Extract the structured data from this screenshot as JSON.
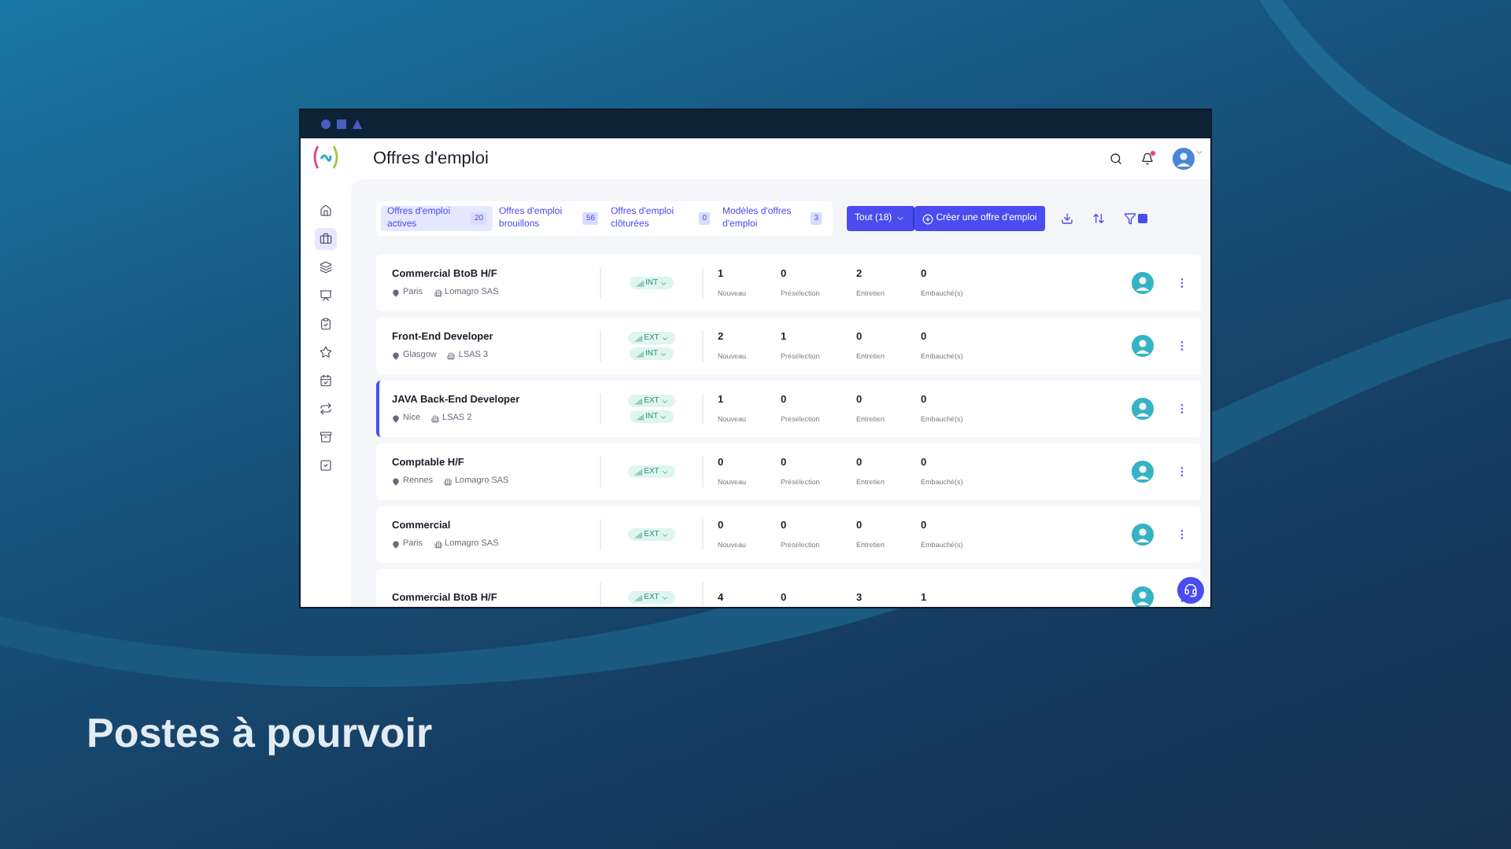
{
  "window": {
    "title": "Offres d'emploi"
  },
  "sidebar": {
    "items": [
      {
        "kind": "home",
        "selected": false
      },
      {
        "kind": "briefcase",
        "selected": true
      },
      {
        "kind": "layers",
        "selected": false
      },
      {
        "kind": "presentation",
        "selected": false
      },
      {
        "kind": "clipboard",
        "selected": false
      },
      {
        "kind": "star",
        "selected": false
      },
      {
        "kind": "calendar",
        "selected": false
      },
      {
        "kind": "repeat",
        "selected": false
      },
      {
        "kind": "archive",
        "selected": false
      },
      {
        "kind": "check",
        "selected": false
      }
    ]
  },
  "tabs": [
    {
      "label": "Offres d'emploi actives",
      "count": "20",
      "selected": true
    },
    {
      "label": "Offres d'emploi brouillons",
      "count": "56",
      "selected": false
    },
    {
      "label": "Offres d'emploi clôturées",
      "count": "0",
      "selected": false
    },
    {
      "label": "Modèles d'offres d'emploi",
      "count": "3",
      "selected": false
    }
  ],
  "filter_button": {
    "label": "Tout (18)"
  },
  "create_button": {
    "label": "Créer une offre d'emploi"
  },
  "rows": [
    {
      "name": "Commercial BtoB H/F",
      "location": "Paris",
      "company": "Lomagro SAS",
      "selected": false,
      "tags": [
        {
          "label": "INT"
        }
      ],
      "stats": [
        {
          "value": "1",
          "label": "Nouveau"
        },
        {
          "value": "0",
          "label": "Présélection"
        },
        {
          "value": "2",
          "label": "Entretien"
        },
        {
          "value": "0",
          "label": "Embauché(s)"
        }
      ]
    },
    {
      "name": "Front-End Developer",
      "location": "Glasgow",
      "company": "LSAS 3",
      "selected": false,
      "tags": [
        {
          "label": "EXT"
        },
        {
          "label": "INT"
        }
      ],
      "stats": [
        {
          "value": "2",
          "label": "Nouveau"
        },
        {
          "value": "1",
          "label": "Présélection"
        },
        {
          "value": "0",
          "label": "Entretien"
        },
        {
          "value": "0",
          "label": "Embauché(s)"
        }
      ]
    },
    {
      "name": "JAVA Back-End Developer",
      "location": "Nice",
      "company": "LSAS 2",
      "selected": true,
      "tags": [
        {
          "label": "EXT"
        },
        {
          "label": "INT"
        }
      ],
      "stats": [
        {
          "value": "1",
          "label": "Nouveau"
        },
        {
          "value": "0",
          "label": "Présélection"
        },
        {
          "value": "0",
          "label": "Entretien"
        },
        {
          "value": "0",
          "label": "Embauché(s)"
        }
      ]
    },
    {
      "name": "Comptable H/F",
      "location": "Rennes",
      "company": "Lomagro SAS",
      "selected": false,
      "tags": [
        {
          "label": "EXT"
        }
      ],
      "stats": [
        {
          "value": "0",
          "label": "Nouveau"
        },
        {
          "value": "0",
          "label": "Présélection"
        },
        {
          "value": "0",
          "label": "Entretien"
        },
        {
          "value": "0",
          "label": "Embauché(s)"
        }
      ]
    },
    {
      "name": "Commercial",
      "location": "Paris",
      "company": "Lomagro SAS",
      "selected": false,
      "tags": [
        {
          "label": "EXT"
        }
      ],
      "stats": [
        {
          "value": "0",
          "label": "Nouveau"
        },
        {
          "value": "0",
          "label": "Présélection"
        },
        {
          "value": "0",
          "label": "Entretien"
        },
        {
          "value": "0",
          "label": "Embauché(s)"
        }
      ]
    },
    {
      "name": "Commercial BtoB H/F",
      "selected": false,
      "tags": [
        {
          "label": "EXT"
        }
      ],
      "stats": [
        {
          "value": "4"
        },
        {
          "value": "0"
        },
        {
          "value": "3"
        },
        {
          "value": "1"
        }
      ]
    }
  ],
  "slide": {
    "heading": "Postes à pourvoir"
  }
}
